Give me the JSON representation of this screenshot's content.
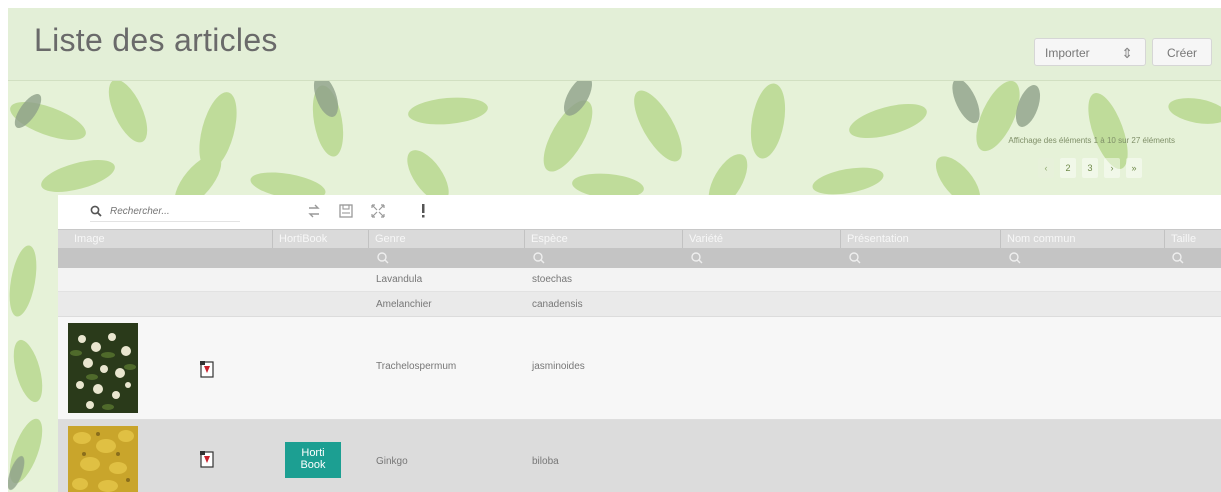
{
  "header": {
    "title": "Liste des articles",
    "import_label": "Importer",
    "import_arrow": "⇕",
    "create_label": "Créer"
  },
  "pagination": {
    "range_text": "Affichage des éléments 1 à 10 sur 27 éléments",
    "pages": [
      "‹",
      "2",
      "3",
      "›",
      "»"
    ],
    "active_page": 1
  },
  "search": {
    "placeholder": "Rechercher..."
  },
  "toolbar": {
    "icons": [
      "swap-icon",
      "save-icon",
      "expand-icon",
      "more-vertical-icon"
    ]
  },
  "table": {
    "columns": [
      "Image",
      "HortiBook",
      "Genre",
      "Espèce",
      "Variété",
      "Présentation",
      "Nom commun",
      "Taille"
    ],
    "rows": [
      {
        "genre": "Lavandula",
        "espece": "stoechas",
        "has_image": false,
        "has_pdf": false,
        "hortibook": false
      },
      {
        "genre": "Amelanchier",
        "espece": "canadensis",
        "has_image": false,
        "has_pdf": false,
        "hortibook": false
      },
      {
        "genre": "Trachelospermum",
        "espece": "jasminoides",
        "has_image": true,
        "has_pdf": true,
        "hortibook": false
      },
      {
        "genre": "Ginkgo",
        "espece": "biloba",
        "has_image": true,
        "has_pdf": true,
        "hortibook": true
      }
    ]
  },
  "hortibook_badge": {
    "line1": "Horti",
    "line2": "Book"
  },
  "colors": {
    "accent": "#1c9f92",
    "banner_bg": "#e6f2d8",
    "header_bg": "#e3efd7",
    "leaf_light": "#b9d88f",
    "leaf_dark": "#8fa08a"
  }
}
